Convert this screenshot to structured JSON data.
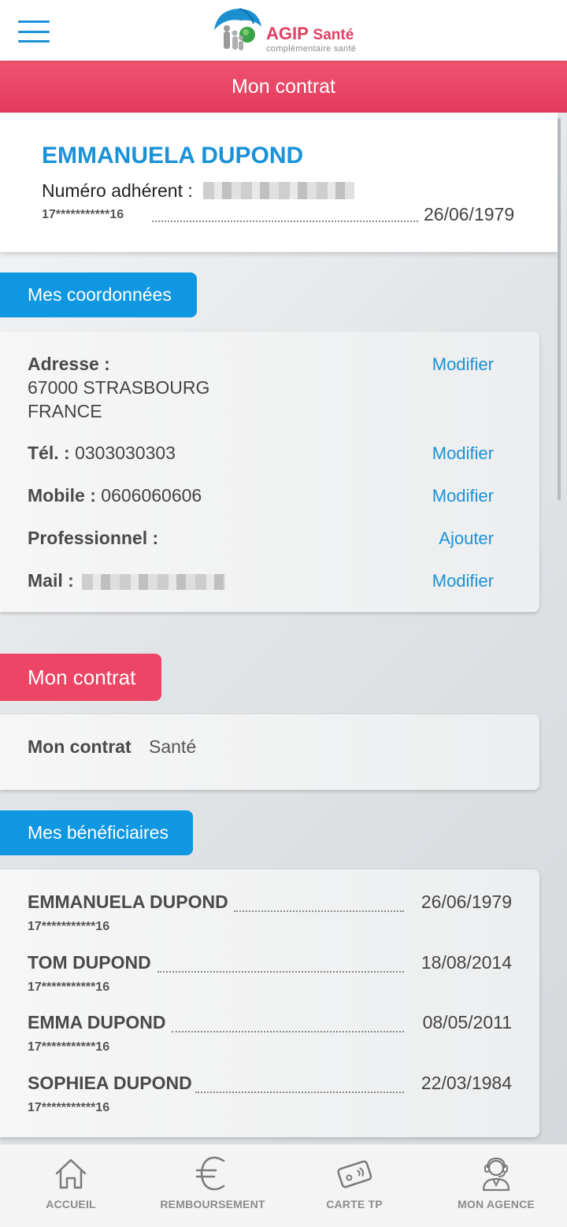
{
  "brand": {
    "name": "AGIP",
    "name_suffix": "Santé",
    "tagline": "complémentaire santé",
    "colors": {
      "blue": "#1a92d8",
      "red": "#e23a5c"
    }
  },
  "header": {
    "title": "Mon contrat"
  },
  "profile": {
    "name": "EMMANUELA DUPOND",
    "adherent_label": "Numéro adhérent :",
    "ssn": "17***********16",
    "birthdate": "26/06/1979"
  },
  "coordonnees": {
    "tab_label": "Mes coordonnées",
    "adresse_label": "Adresse :",
    "adresse_line1": "67000 STRASBOURG",
    "adresse_line2": "FRANCE",
    "adresse_action": "Modifier",
    "tel_label": "Tél. :",
    "tel_value": "0303030303",
    "tel_action": "Modifier",
    "mobile_label": "Mobile :",
    "mobile_value": "0606060606",
    "mobile_action": "Modifier",
    "pro_label": "Professionnel :",
    "pro_action": "Ajouter",
    "mail_label": "Mail :",
    "mail_action": "Modifier"
  },
  "contrat": {
    "tab_label": "Mon contrat",
    "label": "Mon contrat",
    "value": "Santé"
  },
  "beneficiaires": {
    "tab_label": "Mes bénéficiaires",
    "items": [
      {
        "name": "EMMANUELA DUPOND",
        "date": "26/06/1979",
        "ssn": "17***********16"
      },
      {
        "name": "TOM DUPOND",
        "date": "18/08/2014",
        "ssn": "17***********16"
      },
      {
        "name": "EMMA DUPOND",
        "date": "08/05/2011",
        "ssn": "17***********16"
      },
      {
        "name": "SOPHIEA DUPOND",
        "date": "22/03/1984",
        "ssn": "17***********16"
      }
    ]
  },
  "nav": {
    "items": [
      {
        "label": "ACCUEIL",
        "icon": "home-icon"
      },
      {
        "label": "REMBOURSEMENT",
        "icon": "euro-icon"
      },
      {
        "label": "CARTE TP",
        "icon": "card-icon"
      },
      {
        "label": "MON AGENCE",
        "icon": "agent-icon"
      }
    ]
  }
}
